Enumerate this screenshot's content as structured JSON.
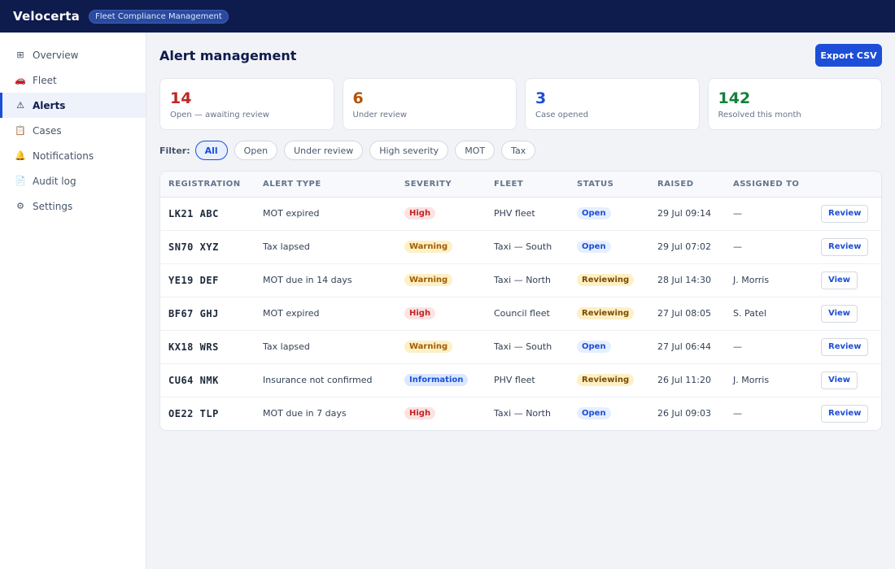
{
  "app": {
    "brand": "Velocerta",
    "badge": "Fleet Compliance Management"
  },
  "sidebar": {
    "items": [
      {
        "label": "Overview",
        "icon": "⊞",
        "icon_name": "grid-icon",
        "active": false
      },
      {
        "label": "Fleet",
        "icon": "🚗",
        "icon_name": "car-icon",
        "active": false
      },
      {
        "label": "Alerts",
        "icon": "⚠",
        "icon_name": "warning-icon",
        "active": true
      },
      {
        "label": "Cases",
        "icon": "📋",
        "icon_name": "clipboard-icon",
        "active": false
      },
      {
        "label": "Notifications",
        "icon": "🔔",
        "icon_name": "bell-icon",
        "active": false
      },
      {
        "label": "Audit log",
        "icon": "📄",
        "icon_name": "document-icon",
        "active": false
      },
      {
        "label": "Settings",
        "icon": "⚙",
        "icon_name": "gear-icon",
        "active": false
      }
    ]
  },
  "page": {
    "title": "Alert management",
    "export_label": "Export CSV"
  },
  "stats": [
    {
      "value": "14",
      "label": "Open — awaiting review",
      "color": "#c02626"
    },
    {
      "value": "6",
      "label": "Under review",
      "color": "#b45309"
    },
    {
      "value": "3",
      "label": "Case opened",
      "color": "#1d4ed8"
    },
    {
      "value": "142",
      "label": "Resolved this month",
      "color": "#15803d"
    }
  ],
  "filters": {
    "label": "Filter:",
    "chips": [
      {
        "label": "All",
        "active": true
      },
      {
        "label": "Open",
        "active": false
      },
      {
        "label": "Under review",
        "active": false
      },
      {
        "label": "High severity",
        "active": false
      },
      {
        "label": "MOT",
        "active": false
      },
      {
        "label": "Tax",
        "active": false
      }
    ]
  },
  "table": {
    "columns": [
      "REGISTRATION",
      "ALERT TYPE",
      "SEVERITY",
      "FLEET",
      "STATUS",
      "RAISED",
      "ASSIGNED TO",
      ""
    ],
    "rows": [
      {
        "registration": "LK21 ABC",
        "alert_type": "MOT expired",
        "severity": "High",
        "fleet": "PHV fleet",
        "status": "Open",
        "raised": "29 Jul 09:14",
        "assigned": "—",
        "action": "Review"
      },
      {
        "registration": "SN70 XYZ",
        "alert_type": "Tax lapsed",
        "severity": "Warning",
        "fleet": "Taxi — South",
        "status": "Open",
        "raised": "29 Jul 07:02",
        "assigned": "—",
        "action": "Review"
      },
      {
        "registration": "YE19 DEF",
        "alert_type": "MOT due in 14 days",
        "severity": "Warning",
        "fleet": "Taxi — North",
        "status": "Reviewing",
        "raised": "28 Jul 14:30",
        "assigned": "J. Morris",
        "action": "View"
      },
      {
        "registration": "BF67 GHJ",
        "alert_type": "MOT expired",
        "severity": "High",
        "fleet": "Council fleet",
        "status": "Reviewing",
        "raised": "27 Jul 08:05",
        "assigned": "S. Patel",
        "action": "View"
      },
      {
        "registration": "KX18 WRS",
        "alert_type": "Tax lapsed",
        "severity": "Warning",
        "fleet": "Taxi — South",
        "status": "Open",
        "raised": "27 Jul 06:44",
        "assigned": "—",
        "action": "Review"
      },
      {
        "registration": "CU64 NMK",
        "alert_type": "Insurance not confirmed",
        "severity": "Information",
        "fleet": "PHV fleet",
        "status": "Reviewing",
        "raised": "26 Jul 11:20",
        "assigned": "J. Morris",
        "action": "View"
      },
      {
        "registration": "OE22 TLP",
        "alert_type": "MOT due in 7 days",
        "severity": "High",
        "fleet": "Taxi — North",
        "status": "Open",
        "raised": "26 Jul 09:03",
        "assigned": "—",
        "action": "Review"
      }
    ]
  }
}
